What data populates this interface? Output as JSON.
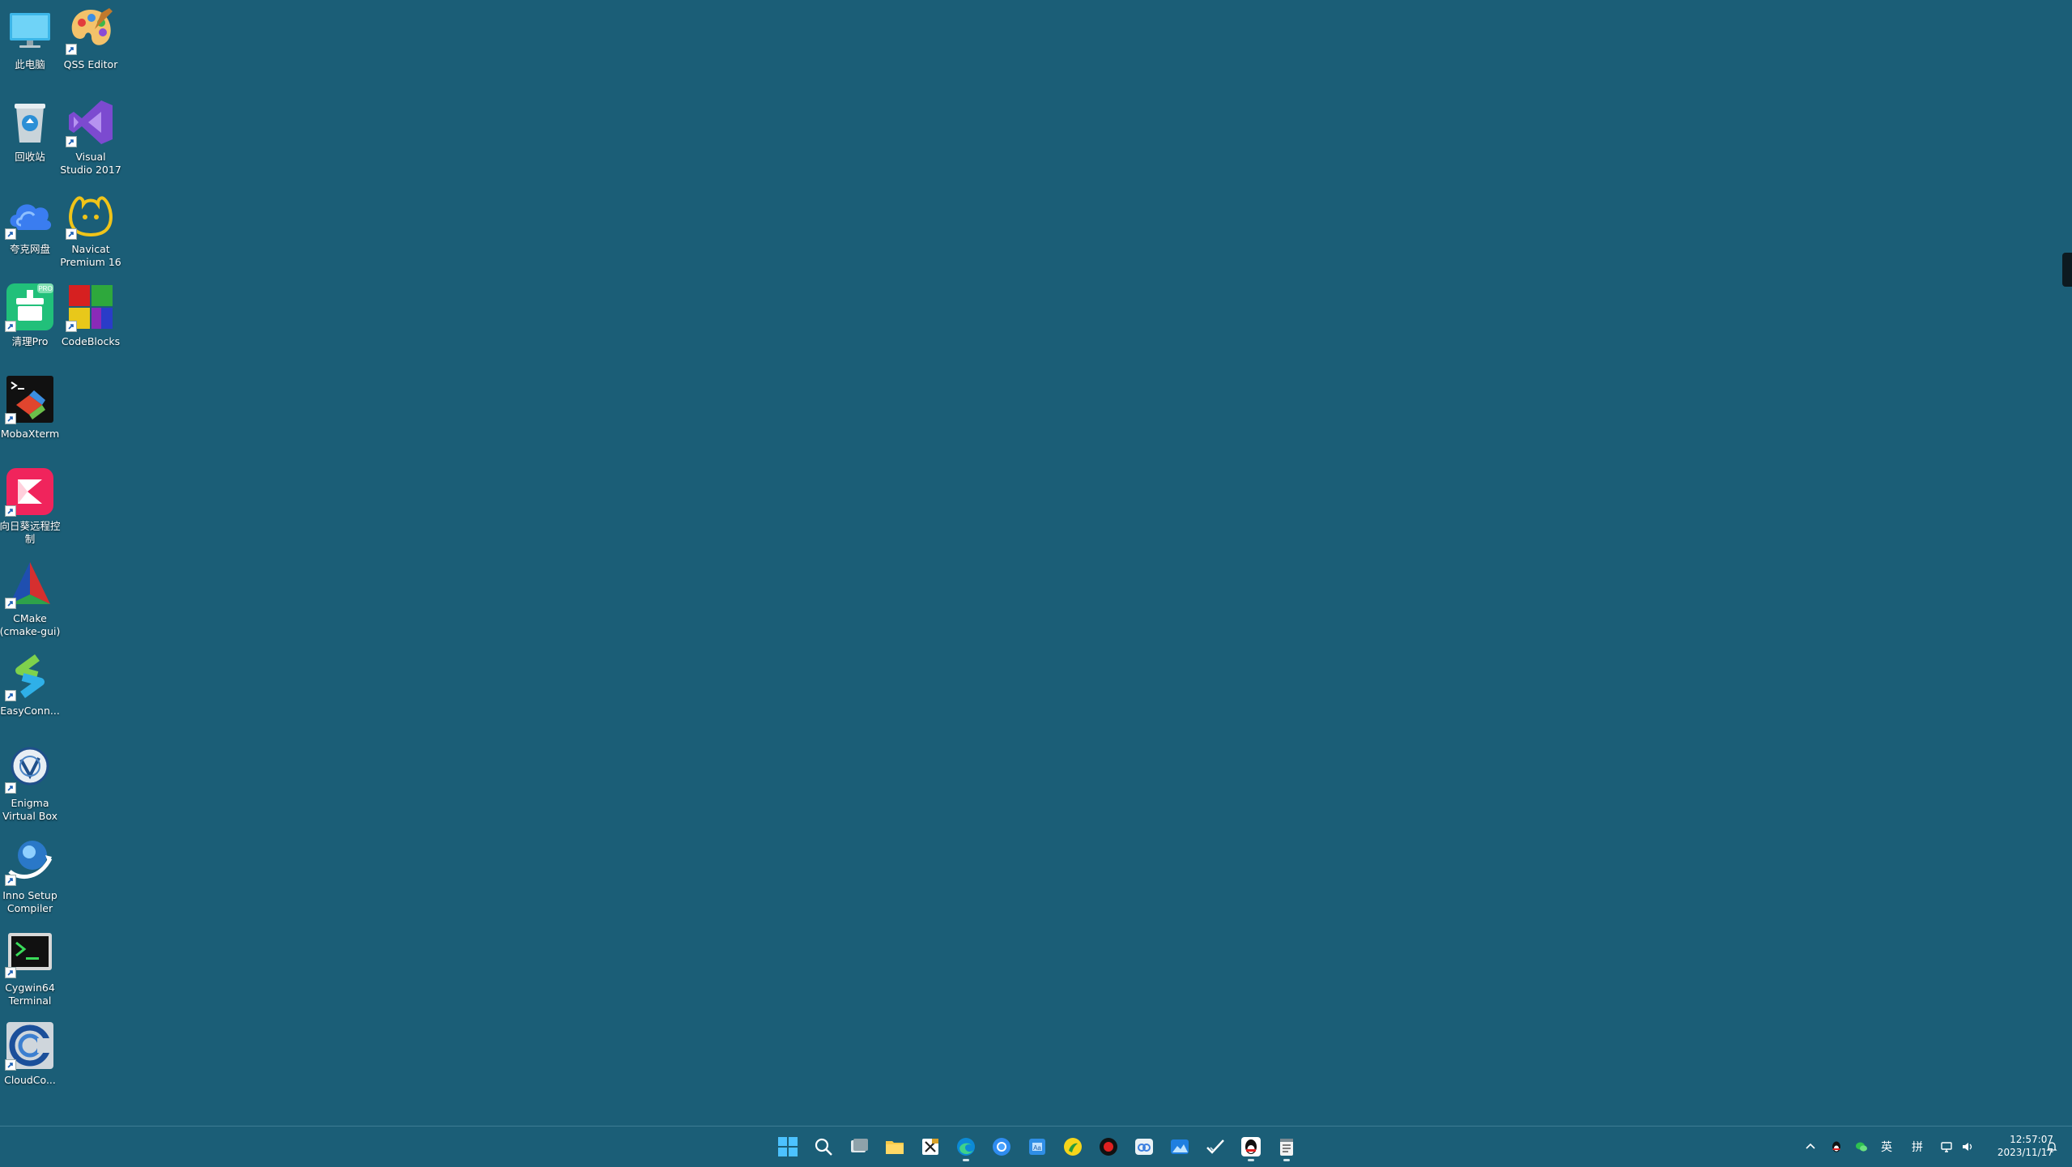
{
  "desktop": {
    "background_color": "#1b5e77",
    "icons": [
      {
        "label": "此电脑",
        "icon": "this-pc-icon"
      },
      {
        "label": "QSS Editor",
        "icon": "palette-icon"
      },
      {
        "label": "回收站",
        "icon": "recycle-bin-icon"
      },
      {
        "label": "Visual Studio 2017",
        "icon": "visual-studio-icon"
      },
      {
        "label": "夸克网盘",
        "icon": "cloud-drive-icon"
      },
      {
        "label": "Navicat Premium 16",
        "icon": "navicat-icon"
      },
      {
        "label": "清理Pro",
        "icon": "cleaner-pro-icon"
      },
      {
        "label": "CodeBlocks",
        "icon": "codeblocks-icon"
      },
      {
        "label": "MobaXterm",
        "icon": "mobaxterm-icon"
      },
      {
        "label": "向日葵远程控制",
        "icon": "sunflower-remote-icon"
      },
      {
        "label": "CMake (cmake-gui)",
        "icon": "cmake-icon"
      },
      {
        "label": "EasyConn...",
        "icon": "easyconnect-icon"
      },
      {
        "label": "Enigma Virtual Box",
        "icon": "enigma-icon"
      },
      {
        "label": "Inno Setup Compiler",
        "icon": "inno-setup-icon"
      },
      {
        "label": "Cygwin64 Terminal",
        "icon": "cygwin-terminal-icon"
      },
      {
        "label": "CloudCo...",
        "icon": "cloudcompare-icon"
      }
    ]
  },
  "taskbar": {
    "apps": [
      {
        "name": "start-button",
        "icon": "windows-start-icon"
      },
      {
        "name": "search-button",
        "icon": "search-icon"
      },
      {
        "name": "task-view-button",
        "icon": "task-view-icon"
      },
      {
        "name": "file-explorer",
        "icon": "folder-icon"
      },
      {
        "name": "excel-app",
        "icon": "excel-icon"
      },
      {
        "name": "edge-browser",
        "icon": "edge-icon",
        "running": true
      },
      {
        "name": "chrome-browser",
        "icon": "chrome-icon"
      },
      {
        "name": "word-app",
        "icon": "word-icon"
      },
      {
        "name": "sunflower-app",
        "icon": "yellow-circle-icon"
      },
      {
        "name": "recorder-app",
        "icon": "record-icon"
      },
      {
        "name": "baidu-netdisk",
        "icon": "baidu-netdisk-icon"
      },
      {
        "name": "photos-app",
        "icon": "photos-icon"
      },
      {
        "name": "todo-app",
        "icon": "checkmark-icon"
      },
      {
        "name": "qq-app",
        "icon": "qq-penguin-icon",
        "running": true
      },
      {
        "name": "notepad-app",
        "icon": "notepad-icon",
        "running": true
      }
    ],
    "tray": {
      "chevron": "chevron-up-icon",
      "ime_lang": "英",
      "ime_mode": "拼",
      "time": "12:57:07",
      "date": "2023/11/17"
    }
  }
}
